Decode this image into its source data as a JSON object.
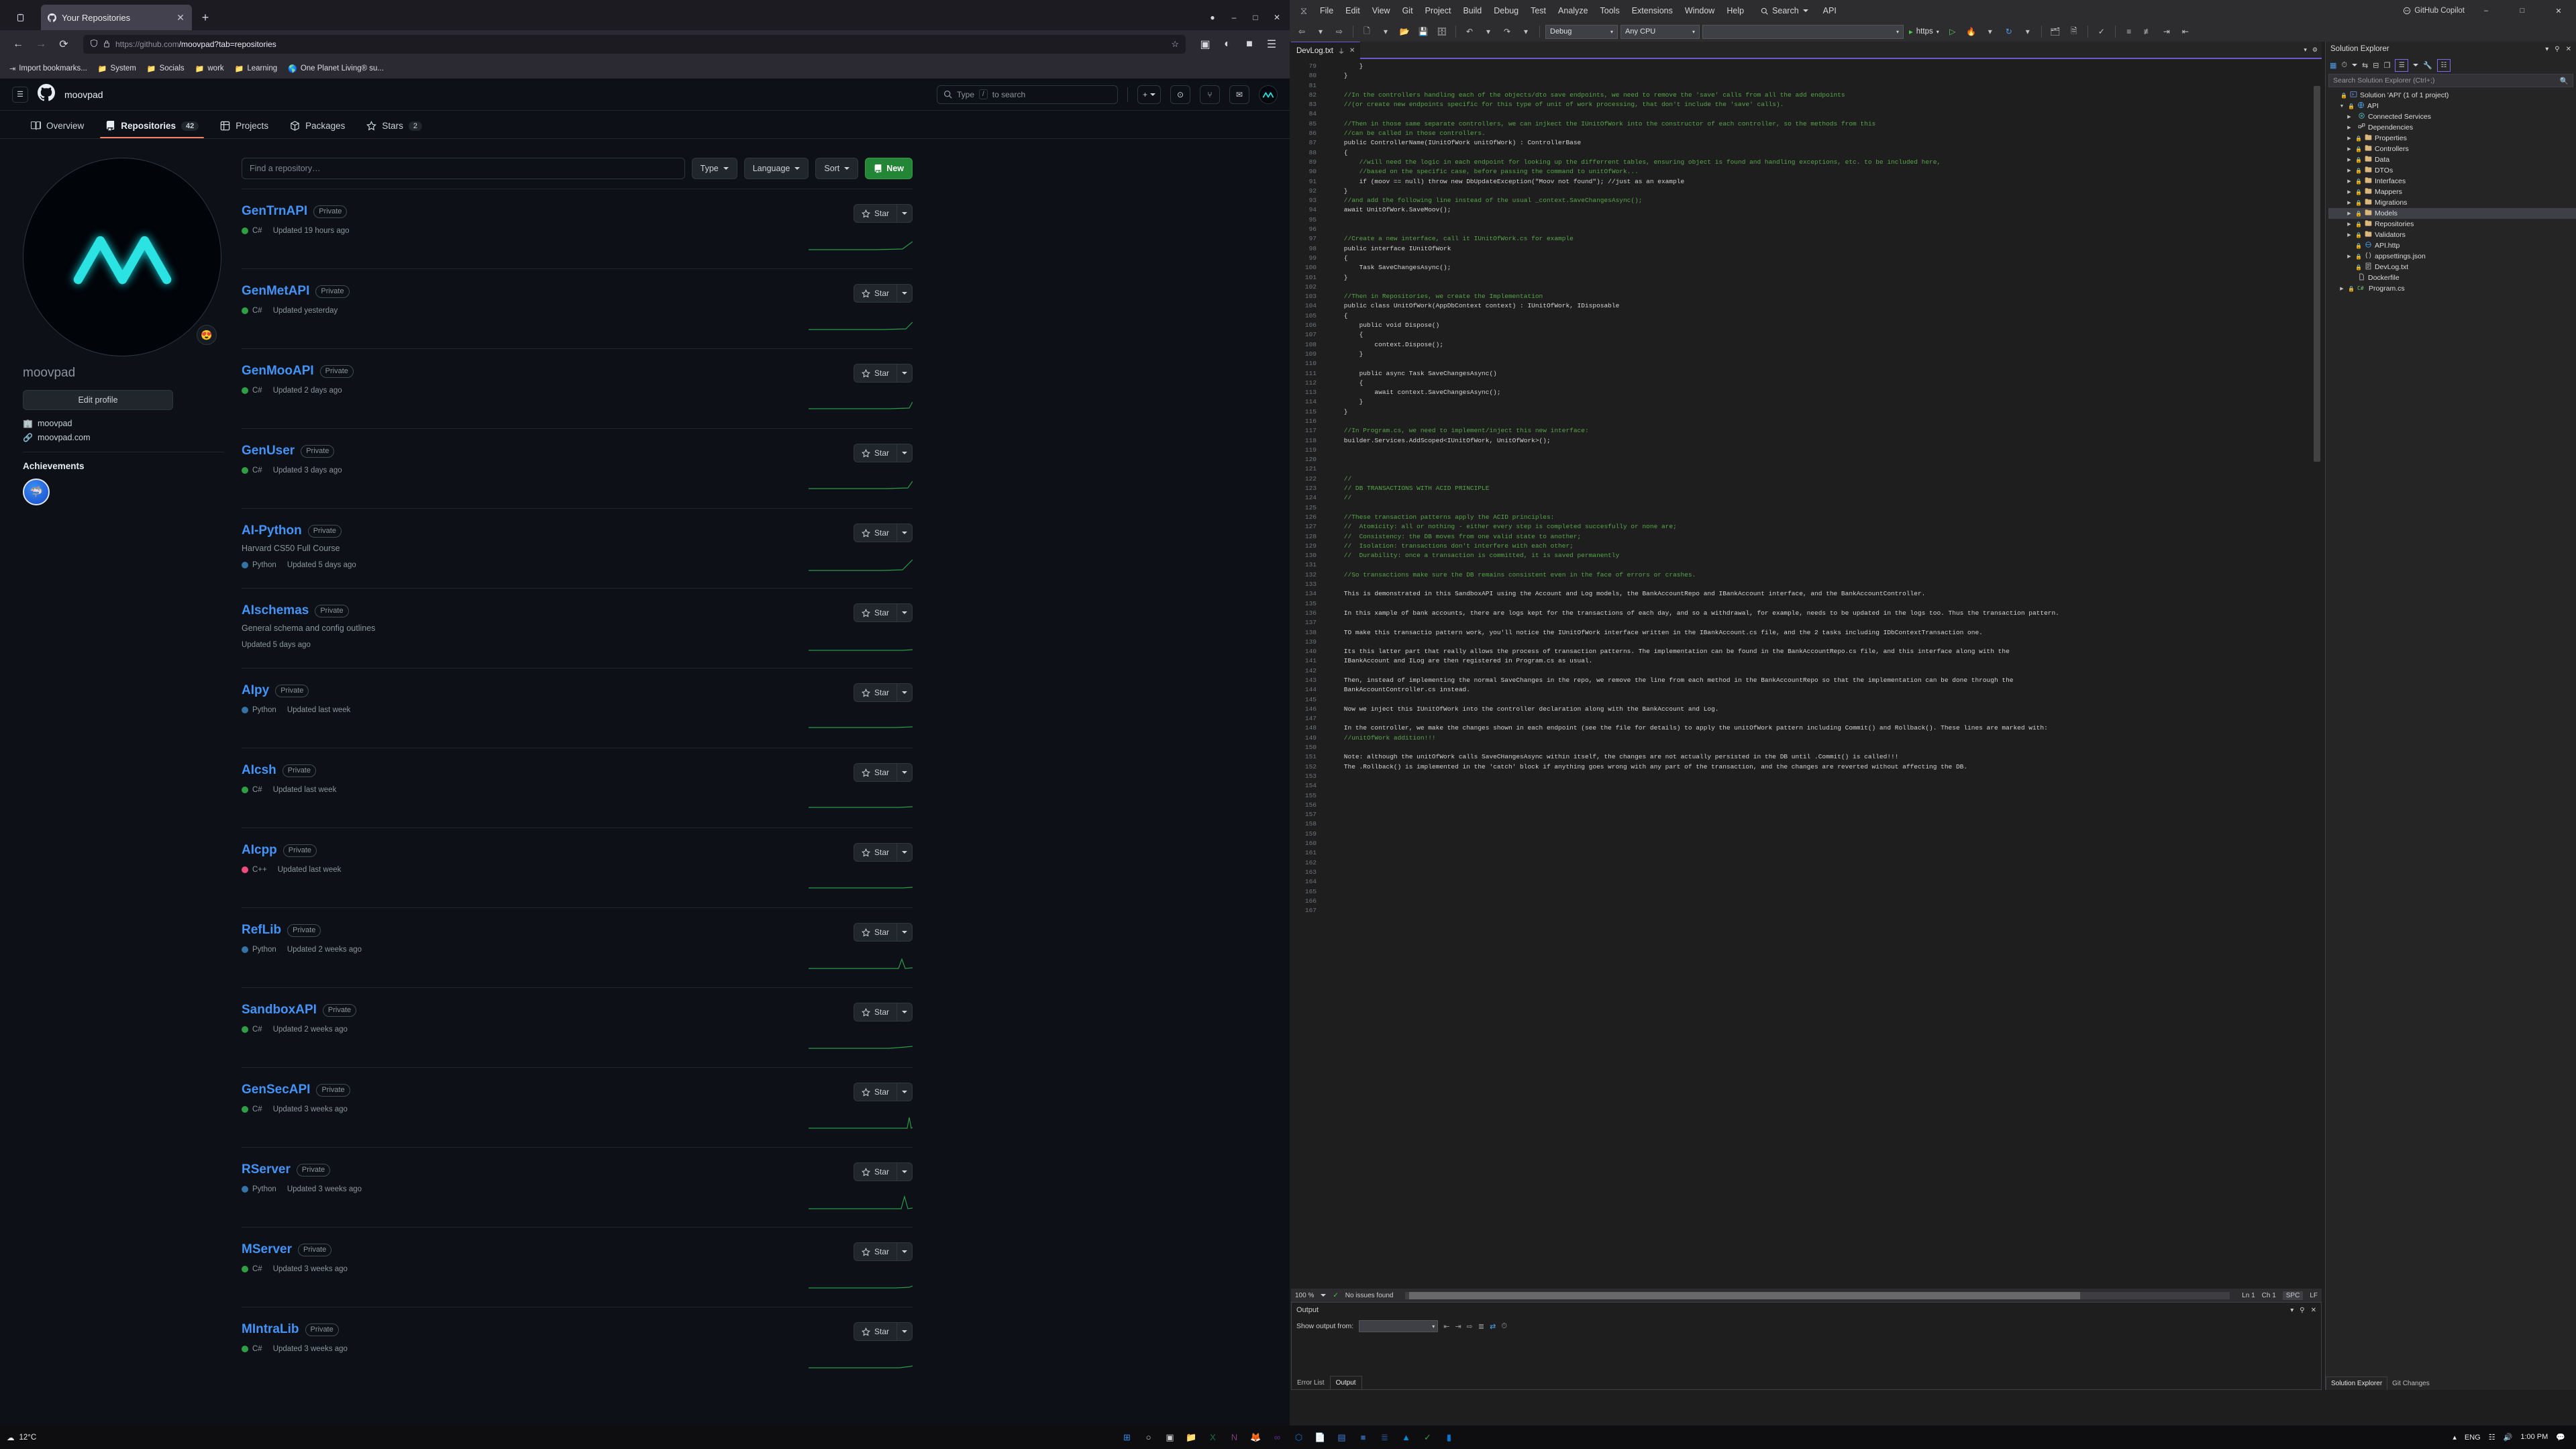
{
  "browser": {
    "tab": {
      "title": "Your Repositories",
      "favicon": "github-icon",
      "close": "✕"
    },
    "newtab_label": "+",
    "window_controls": {
      "minimize": "–",
      "maximize": "□",
      "close": "✕"
    },
    "nav": {
      "back": "←",
      "forward": "→",
      "reload": "⟳"
    },
    "url": {
      "scheme_host": "https://github.com",
      "path": "/moovpad?tab=repositories",
      "shield": "⬟",
      "lock": "🔒",
      "star": "☆"
    },
    "bookmarks": [
      {
        "label": "Import bookmarks...",
        "icon": "import-icon"
      },
      {
        "label": "System",
        "icon": "folder-icon"
      },
      {
        "label": "Socials",
        "icon": "folder-icon"
      },
      {
        "label": "work",
        "icon": "folder-icon"
      },
      {
        "label": "Learning",
        "icon": "folder-icon"
      },
      {
        "label": "One Planet Living® su...",
        "icon": "globe-icon"
      }
    ]
  },
  "github": {
    "header": {
      "username": "moovpad",
      "search_placeholder": "Type  /  to search",
      "search_kbd": "/",
      "buttons": [
        {
          "name": "create-new",
          "label": "+"
        },
        {
          "name": "issues",
          "label": "⊙"
        },
        {
          "name": "pull-requests",
          "label": "⑂"
        },
        {
          "name": "notifications",
          "label": "✉"
        }
      ]
    },
    "nav_tabs": [
      {
        "label": "Overview",
        "icon": "book-icon",
        "count": "",
        "active": false
      },
      {
        "label": "Repositories",
        "icon": "repo-icon",
        "count": "42",
        "active": true
      },
      {
        "label": "Projects",
        "icon": "table-icon",
        "count": "",
        "active": false
      },
      {
        "label": "Packages",
        "icon": "package-icon",
        "count": "",
        "active": false
      },
      {
        "label": "Stars",
        "icon": "star-icon",
        "count": "2",
        "active": false
      }
    ],
    "profile": {
      "avatar_alt": "moovpad-avatar",
      "status_emoji": "😍",
      "name": "moovpad",
      "edit_button": "Edit profile",
      "organization": "moovpad",
      "website": "moovpad.com",
      "achievements_title": "Achievements",
      "achievement_badge": "🦈"
    },
    "filters": {
      "find_placeholder": "Find a repository…",
      "type": "Type",
      "language": "Language",
      "sort": "Sort",
      "new": "New"
    },
    "repositories": [
      {
        "name": "GenTrnAPI",
        "visibility": "Private",
        "description": "",
        "language": "C#",
        "lang_color": "#2ea043",
        "updated": "Updated 19 hours ago"
      },
      {
        "name": "GenMetAPI",
        "visibility": "Private",
        "description": "",
        "language": "C#",
        "lang_color": "#2ea043",
        "updated": "Updated yesterday"
      },
      {
        "name": "GenMooAPI",
        "visibility": "Private",
        "description": "",
        "language": "C#",
        "lang_color": "#2ea043",
        "updated": "Updated 2 days ago"
      },
      {
        "name": "GenUser",
        "visibility": "Private",
        "description": "",
        "language": "C#",
        "lang_color": "#2ea043",
        "updated": "Updated 3 days ago"
      },
      {
        "name": "AI-Python",
        "visibility": "Private",
        "description": "Harvard CS50 Full Course",
        "language": "Python",
        "lang_color": "#3572A5",
        "updated": "Updated 5 days ago"
      },
      {
        "name": "AIschemas",
        "visibility": "Private",
        "description": "General schema and config outlines",
        "language": "",
        "lang_color": "",
        "updated": "Updated 5 days ago"
      },
      {
        "name": "AIpy",
        "visibility": "Private",
        "description": "",
        "language": "Python",
        "lang_color": "#3572A5",
        "updated": "Updated last week"
      },
      {
        "name": "AIcsh",
        "visibility": "Private",
        "description": "",
        "language": "C#",
        "lang_color": "#2ea043",
        "updated": "Updated last week"
      },
      {
        "name": "AIcpp",
        "visibility": "Private",
        "description": "",
        "language": "C++",
        "lang_color": "#f34b7d",
        "updated": "Updated last week"
      },
      {
        "name": "RefLib",
        "visibility": "Private",
        "description": "",
        "language": "Python",
        "lang_color": "#3572A5",
        "updated": "Updated 2 weeks ago"
      },
      {
        "name": "SandboxAPI",
        "visibility": "Private",
        "description": "",
        "language": "C#",
        "lang_color": "#2ea043",
        "updated": "Updated 2 weeks ago"
      },
      {
        "name": "GenSecAPI",
        "visibility": "Private",
        "description": "",
        "language": "C#",
        "lang_color": "#2ea043",
        "updated": "Updated 3 weeks ago"
      },
      {
        "name": "RServer",
        "visibility": "Private",
        "description": "",
        "language": "Python",
        "lang_color": "#3572A5",
        "updated": "Updated 3 weeks ago"
      },
      {
        "name": "MServer",
        "visibility": "Private",
        "description": "",
        "language": "C#",
        "lang_color": "#2ea043",
        "updated": "Updated 3 weeks ago"
      },
      {
        "name": "MIntraLib",
        "visibility": "Private",
        "description": "",
        "language": "C#",
        "lang_color": "#2ea043",
        "updated": "Updated 3 weeks ago"
      }
    ],
    "star_label": "Star"
  },
  "vs": {
    "menu": [
      "File",
      "Edit",
      "View",
      "Git",
      "Project",
      "Build",
      "Debug",
      "Test",
      "Analyze",
      "Tools",
      "Extensions",
      "Window",
      "Help"
    ],
    "search_label": "Search",
    "solution_label": "API",
    "copilot_label": "GitHub Copilot",
    "toolbar": {
      "config": "Debug",
      "platform": "Any CPU",
      "target_blank": "",
      "run_label": "https"
    },
    "editor_tab": {
      "title": "DevLog.txt",
      "pin": "⏚",
      "close": "✕"
    },
    "code_start_line": 79,
    "code_lines": [
      "        }",
      "    }",
      "",
      "    //In the controllers handling each of the objects/dto save endpoints, we need to remove the 'save' calls from all the add endpoints",
      "    //(or create new endpoints specific for this type of unit of work processing, that don't include the 'save' calls).",
      "",
      "    //Then in those same separate controllers, we can injkect the IUnitOfWork into the constructor of each controller, so the methods from this",
      "    //can be called in those controllers.",
      "    public ControllerName(IUnitOfWork unitOfWork) : ControllerBase",
      "    {",
      "        //will need the logic in each endpoint for looking up the differrent tables, ensuring object is found and handling exceptions, etc. to be included here,",
      "        //based on the specific case, before passing the command to unitOfWork...",
      "        if (moov == null) throw new DbUpdateException(\"Moov not found\"); //just as an example",
      "    }",
      "    //and add the following line instead of the usual _context.SaveChangesAsync();",
      "    await UnitOfWork.SaveMoov();",
      "",
      "",
      "    //Create a new interface, call it IUnitOfWork.cs for example",
      "    public interface IUnitOfWork",
      "    {",
      "        Task SaveChangesAsync();",
      "    }",
      "",
      "    //Then in Repositories, we create the Implementation",
      "    public class UnitOfWork(AppDbContext context) : IUnitOfWork, IDisposable",
      "    {",
      "        public void Dispose()",
      "        {",
      "            context.Dispose();",
      "        }",
      "",
      "        public async Task SaveChangesAsync()",
      "        {",
      "            await context.SaveChangesAsync();",
      "        }",
      "    }",
      "",
      "    //In Program.cs, we need to implement/inject this new interface:",
      "    builder.Services.AddScoped<IUnitOfWork, UnitOfWork>();",
      "",
      "",
      "",
      "    //",
      "    // DB TRANSACTIONS WITH ACID PRINCIPLE",
      "    //",
      "",
      "    //These transaction patterns apply the ACID principles:",
      "    //  Atomicity: all or nothing - either every step is completed succesfully or none are;",
      "    //  Consistency: the DB moves from one valid state to another;",
      "    //  Isolation: transactions don't interfere with each other;",
      "    //  Durability: once a transaction is committed, it is saved permanently",
      "",
      "    //So transactions make sure the DB remains consistent even in the face of errors or crashes.",
      "",
      "    This is demonstrated in this SandboxAPI using the Account and Log models, the BankAccountRepo and IBankAccount interface, and the BankAccountController.",
      "",
      "    In this xample of bank accounts, there are logs kept for the transactions of each day, and so a withdrawal, for example, needs to be updated in the logs too. Thus the transaction pattern.",
      "",
      "    TO make this transactio pattern work, you'll notice the IUnitOfWork interface written in the IBankAccount.cs file, and the 2 tasks including IDbContextTransaction one.",
      "",
      "    Its this latter part that really allows the process of transaction patterns. The implementation can be found in the BankAccountRepo.cs file, and this interface along with the",
      "    IBankAccount and ILog are then registered in Program.cs as usual.",
      "",
      "    Then, instead of implementing the normal SaveChanges in the repo, we remove the line from each method in the BankAccountRepo so that the implementation can be done through the",
      "    BankAccountController.cs instead.",
      "",
      "    Now we inject this IUnitOfWork into the controller declaration along with the BankAccount and Log.",
      "",
      "    In the controller, we make the changes shown in each endpoint (see the file for details) to apply the unitOfWork pattern including Commit() and Rollback(). These lines are marked with:",
      "    //unitOfWork addition!!!",
      "",
      "    Note: although the unitOfWork calls SaveCHangesAsync within itself, the changes are not actually persisted in the DB until .Commit() is called!!!",
      "    The .Rollback() is implemented in the 'catch' block if anything goes wrong with any part of the transaction, and the changes are reverted without affecting the DB.",
      "",
      "",
      "",
      "",
      "",
      "",
      "",
      "",
      "",
      "",
      "",
      "",
      "",
      "",
      ""
    ],
    "editor_status": {
      "zoom": "100 %",
      "issues": "No issues found",
      "line": "Ln 1",
      "col": "Ch 1",
      "spaces": "SPC",
      "eol": "LF"
    },
    "output": {
      "title": "Output",
      "show_output_from_label": "Show output from:",
      "show_output_from_value": "",
      "tabs": [
        {
          "label": "Error List",
          "active": false
        },
        {
          "label": "Output",
          "active": true
        }
      ]
    },
    "solution_explorer": {
      "title": "Solution Explorer",
      "search_placeholder": "Search Solution Explorer (Ctrl+;)",
      "tree": [
        {
          "label": "Solution 'API' (1 of 1 project)",
          "depth": 0,
          "arrow": "",
          "icon": "solution-icon",
          "lock": true,
          "selected": false
        },
        {
          "label": "API",
          "depth": 1,
          "arrow": "▼",
          "icon": "project-icon",
          "lock": true,
          "selected": false
        },
        {
          "label": "Connected Services",
          "depth": 2,
          "arrow": "▶",
          "icon": "services-icon",
          "lock": false,
          "selected": false
        },
        {
          "label": "Dependencies",
          "depth": 2,
          "arrow": "▶",
          "icon": "dependencies-icon",
          "lock": false,
          "selected": false
        },
        {
          "label": "Properties",
          "depth": 2,
          "arrow": "▶",
          "icon": "folder-icon",
          "lock": true,
          "selected": false
        },
        {
          "label": "Controllers",
          "depth": 2,
          "arrow": "▶",
          "icon": "folder-icon",
          "lock": true,
          "selected": false
        },
        {
          "label": "Data",
          "depth": 2,
          "arrow": "▶",
          "icon": "folder-icon",
          "lock": true,
          "selected": false
        },
        {
          "label": "DTOs",
          "depth": 2,
          "arrow": "▶",
          "icon": "folder-icon",
          "lock": true,
          "selected": false
        },
        {
          "label": "Interfaces",
          "depth": 2,
          "arrow": "▶",
          "icon": "folder-icon",
          "lock": true,
          "selected": false
        },
        {
          "label": "Mappers",
          "depth": 2,
          "arrow": "▶",
          "icon": "folder-icon",
          "lock": true,
          "selected": false
        },
        {
          "label": "Migrations",
          "depth": 2,
          "arrow": "▶",
          "icon": "folder-icon",
          "lock": true,
          "selected": false
        },
        {
          "label": "Models",
          "depth": 2,
          "arrow": "▶",
          "icon": "folder-icon",
          "lock": true,
          "selected": true
        },
        {
          "label": "Repositories",
          "depth": 2,
          "arrow": "▶",
          "icon": "folder-icon",
          "lock": true,
          "selected": false
        },
        {
          "label": "Validators",
          "depth": 2,
          "arrow": "▶",
          "icon": "folder-icon",
          "lock": true,
          "selected": false
        },
        {
          "label": "API.http",
          "depth": 2,
          "arrow": "",
          "icon": "http-icon",
          "lock": true,
          "selected": false
        },
        {
          "label": "appsettings.json",
          "depth": 2,
          "arrow": "▶",
          "icon": "json-icon",
          "lock": true,
          "selected": false
        },
        {
          "label": "DevLog.txt",
          "depth": 2,
          "arrow": "",
          "icon": "text-icon",
          "lock": true,
          "selected": false
        },
        {
          "label": "Dockerfile",
          "depth": 2,
          "arrow": "",
          "icon": "file-icon",
          "lock": false,
          "selected": false
        },
        {
          "label": "Program.cs",
          "depth": 1,
          "arrow": "▶",
          "icon": "csharp-icon",
          "lock": true,
          "selected": false
        }
      ],
      "bottom_tabs": [
        {
          "label": "Solution Explorer",
          "active": true
        },
        {
          "label": "Git Changes",
          "active": false
        }
      ]
    }
  },
  "taskbar": {
    "weather_temp": "12°C",
    "weather_icon": "☁",
    "apps": [
      {
        "name": "start-button",
        "glyph": "⊞",
        "color": "#2d8ceb"
      },
      {
        "name": "search-button",
        "glyph": "○",
        "color": "#cfcfcf"
      },
      {
        "name": "task-view",
        "glyph": "▣",
        "color": "#cfcfcf"
      },
      {
        "name": "file-explorer",
        "glyph": "📁",
        "color": "#f5c046"
      },
      {
        "name": "excel-app",
        "glyph": "X",
        "color": "#1d6f42"
      },
      {
        "name": "onenote-app",
        "glyph": "N",
        "color": "#80397b"
      },
      {
        "name": "firefox-app",
        "glyph": "🦊",
        "color": "#e66000"
      },
      {
        "name": "visual-studio-app",
        "glyph": "∞",
        "color": "#5c2d91"
      },
      {
        "name": "vscode-app",
        "glyph": "⬡",
        "color": "#0078d4"
      },
      {
        "name": "pdf-app",
        "glyph": "📄",
        "color": "#b3362a"
      },
      {
        "name": "sql-app",
        "glyph": "▤",
        "color": "#3b7dd8"
      },
      {
        "name": "terminal-app",
        "glyph": "■",
        "color": "#2b5797"
      },
      {
        "name": "docs-app",
        "glyph": "≣",
        "color": "#2b579a"
      },
      {
        "name": "azure-app",
        "glyph": "▲",
        "color": "#0089d6"
      },
      {
        "name": "checks-app",
        "glyph": "✓",
        "color": "#2ea043"
      },
      {
        "name": "store-app",
        "glyph": "▮",
        "color": "#0078d4"
      }
    ],
    "tray": {
      "language": "ENG",
      "network": "☷",
      "volume": "ᴀ",
      "time": "1:00 PM"
    }
  }
}
